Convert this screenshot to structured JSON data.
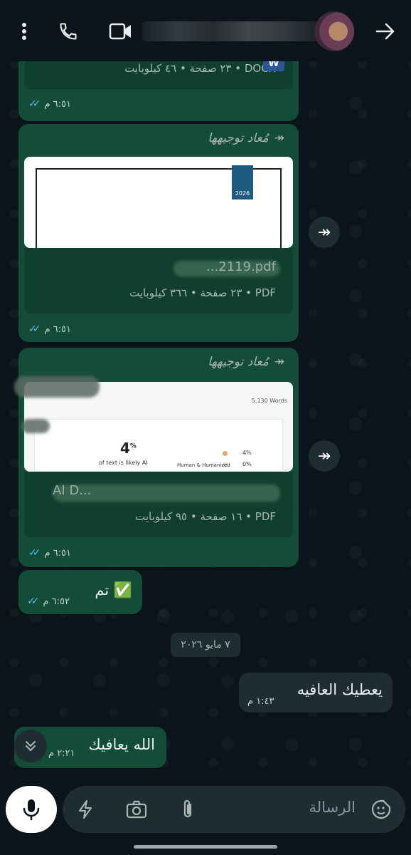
{
  "header": {
    "menu_icon": "more-vert-icon",
    "call_icon": "phone-icon",
    "video_icon": "video-icon",
    "back_icon": "arrow-right-icon"
  },
  "messages": [
    {
      "type": "document",
      "file_type": "DOCX",
      "info": "٢٣ صفحة • ٤٦ كيلوبايت • DOCX",
      "time": "٦:٥١ م"
    },
    {
      "type": "document",
      "forwarded_label": "مُعاد توجيهها",
      "preview_badge": "2026",
      "file_name": "...2119.pdf",
      "info": "٢٣ صفحة • ٣٦٦ كيلوبايت • PDF",
      "time": "٦:٥١ م"
    },
    {
      "type": "document",
      "forwarded_label": "مُعاد توجيهها",
      "preview": {
        "word_count": "5,130 Words",
        "percent": "4",
        "percent_sign": "%",
        "likely_ai": "of text is likely AI",
        "legend_value_1": "4%",
        "legend_value_2": "0%",
        "legend_label_2": "Human & Humanized"
      },
      "file_name": "AI D...",
      "info": "١٦ صفحة • ٩٥ كيلوبايت • PDF",
      "time": "٦:٥١ م"
    },
    {
      "type": "text",
      "text": "تم ✅",
      "time": "٦:٥٢ م"
    }
  ],
  "date_chip": "٧ مايو ٢٠٢٦",
  "incoming": {
    "text": "يعطيك العافيه",
    "time": "١:٤٣ م"
  },
  "last_message": {
    "text": "الله يعافيك",
    "time": "٢:٢١ م"
  },
  "composer": {
    "placeholder": "الرسالة",
    "mic_icon": "mic-icon",
    "bolt_icon": "bolt-icon",
    "camera_icon": "camera-icon",
    "attach_icon": "paperclip-icon",
    "sticker_icon": "sticker-icon"
  },
  "colors": {
    "background": "#0b141a",
    "outgoing_bubble": "#144d37",
    "incoming_bubble": "#1f2c34",
    "read_ticks": "#53bdeb"
  }
}
